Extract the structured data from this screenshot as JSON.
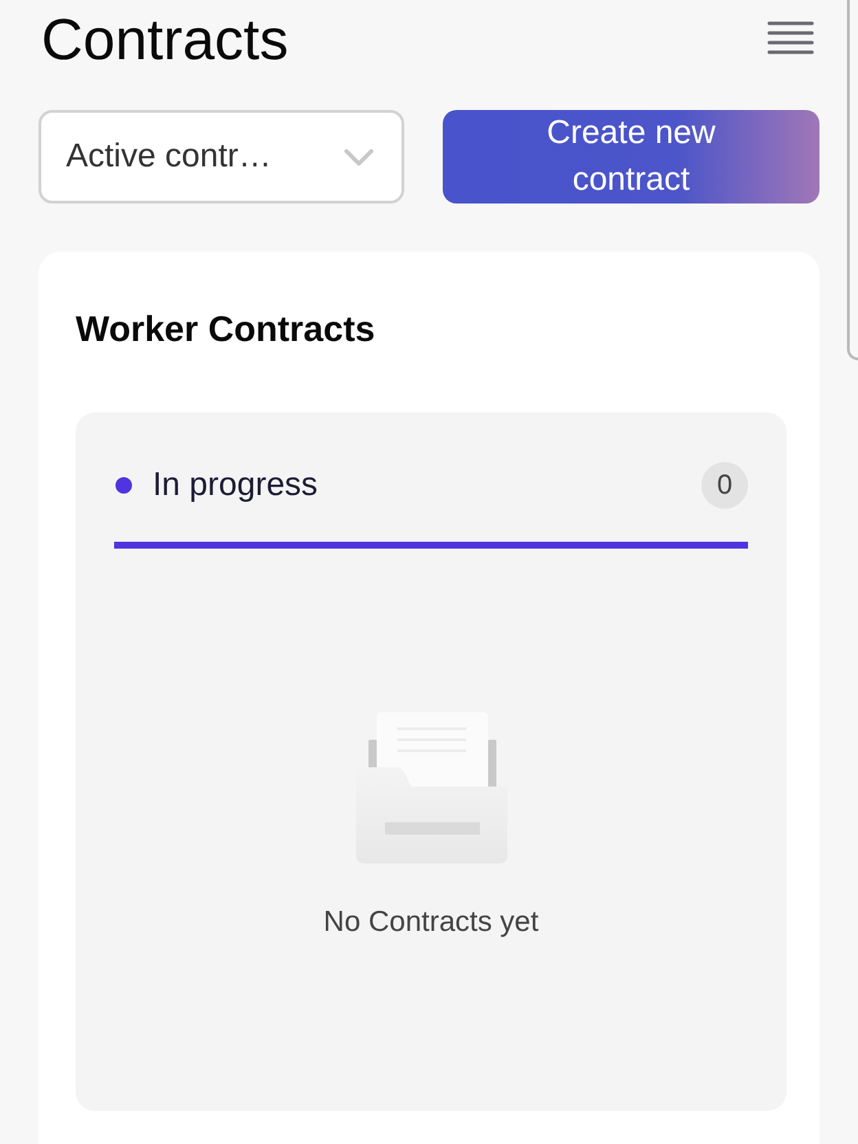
{
  "header": {
    "title": "Contracts"
  },
  "toolbar": {
    "filter": {
      "value": "Active contr…"
    },
    "create_button": {
      "label": "Create new contract"
    }
  },
  "card": {
    "title": "Worker Contracts",
    "columns": [
      {
        "title": "In progress",
        "count": "0",
        "color": "#5034e0",
        "empty_text": "No Contracts yet"
      }
    ]
  }
}
